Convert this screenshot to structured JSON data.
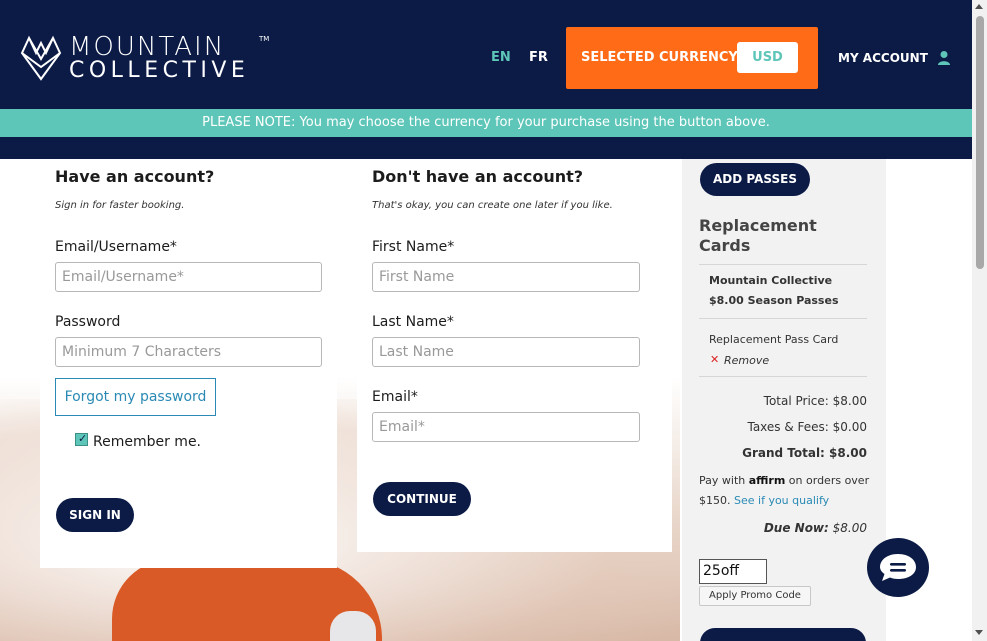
{
  "header": {
    "logo_line1": "MOUNTAIN",
    "logo_tm": "TM",
    "logo_line2": "COLLECTIVE",
    "lang_en": "EN",
    "lang_fr": "FR",
    "currency_label": "SELECTED CURRENCY:",
    "currency_value": "USD",
    "my_account": "MY ACCOUNT",
    "logo_icon": "mountain-logo-icon",
    "account_icon": "user-icon"
  },
  "notice": "PLEASE NOTE: You may choose the currency for your purchase using the button above.",
  "signin": {
    "title": "Have an account?",
    "subtitle": "Sign in for faster booking.",
    "email_label": "Email/Username*",
    "email_placeholder": "Email/Username*",
    "password_label": "Password",
    "password_placeholder": "Minimum 7 Characters",
    "forgot": "Forgot my password",
    "remember": "Remember me.",
    "remember_checked": true,
    "button": "SIGN IN"
  },
  "signup": {
    "title": "Don't have an account?",
    "subtitle": "That's okay, you can create one later if you like.",
    "first_label": "First Name*",
    "first_placeholder": "First Name",
    "last_label": "Last Name*",
    "last_placeholder": "Last Name",
    "email_label": "Email*",
    "email_placeholder": "Email*",
    "button": "CONTINUE"
  },
  "cart": {
    "add_passes": "ADD PASSES",
    "heading": "Replacement Cards",
    "item_title": "Mountain Collective $8.00 Season Passes",
    "item_name": "Replacement Pass Card",
    "remove": "Remove",
    "total_price": "Total Price: $8.00",
    "taxes": "Taxes & Fees: $0.00",
    "grand_total": "Grand Total: $8.00",
    "affirm_pre": "Pay with ",
    "affirm_logo": "affirm",
    "affirm_post": " on orders over $150. ",
    "affirm_link": "See if you qualify",
    "due_label": "Due Now:",
    "due_value": " $8.00",
    "promo_value": "25off",
    "promo_button": "Apply Promo Code"
  },
  "colors": {
    "navy": "#0b1b46",
    "teal": "#5ec6b8",
    "orange": "#ff6b16",
    "link": "#2a8ab5"
  },
  "chat_icon": "chat-bubble-icon"
}
